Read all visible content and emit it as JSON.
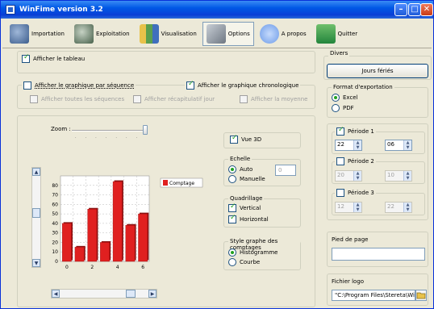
{
  "titlebar": {
    "title": "WinFime version 3.2"
  },
  "toolbar": {
    "items": [
      {
        "label": "Importation"
      },
      {
        "label": "Exploitation"
      },
      {
        "label": "Visualisation"
      },
      {
        "label": "Options"
      },
      {
        "label": "A propos"
      },
      {
        "label": "Quitter"
      }
    ]
  },
  "options": {
    "afficher_tableau": "Afficher le tableau",
    "graph_sequence": "Afficher le graphique par séquence",
    "graph_chrono": "Afficher le graphique chronologique",
    "toutes_sequences": "Afficher toutes les séquences",
    "recapitulatif": "Afficher récapitulatif jour",
    "moyenne": "Afficher la moyenne"
  },
  "preview": {
    "zoom_label": "Zoom :",
    "vue3d": "Vue 3D",
    "echelle_label": "Echelle",
    "auto": "Auto",
    "manuelle": "Manuelle",
    "echelle_value": "0",
    "quadrillage_label": "Quadrillage",
    "vertical": "Vertical",
    "horizontal": "Horizontal",
    "style_label": "Style graphe des comptages",
    "histogramme": "Histogramme",
    "courbe": "Courbe"
  },
  "divers": {
    "label": "Divers",
    "jours_feries": "Jours fériés",
    "format_label": "Format d'exportation",
    "excel": "Excel",
    "pdf": "PDF",
    "periode1": "Période 1",
    "periode1_from": "22",
    "periode1_to": "06",
    "periode2": "Période 2",
    "periode2_from": "20",
    "periode2_to": "10",
    "periode3": "Période 3",
    "periode3_from": "12",
    "periode3_to": "22",
    "pied_label": "Pied de page",
    "pied_value": "",
    "logo_label": "Fichier logo",
    "logo_value": "\"C:\\Program Files\\Stereta\\Winfi"
  },
  "chart_data": {
    "type": "bar",
    "x": [
      0,
      1,
      2,
      3,
      4,
      5,
      6
    ],
    "values": [
      40,
      15,
      55,
      20,
      84,
      38,
      50
    ],
    "ylim": [
      0,
      90
    ],
    "yticks": [
      "80",
      "70",
      "60",
      "50",
      "40",
      "30",
      "20",
      "10",
      "0"
    ],
    "xticks": [
      "0",
      "2",
      "4",
      "6"
    ],
    "legend": "Comptage",
    "color": "#e02020"
  }
}
